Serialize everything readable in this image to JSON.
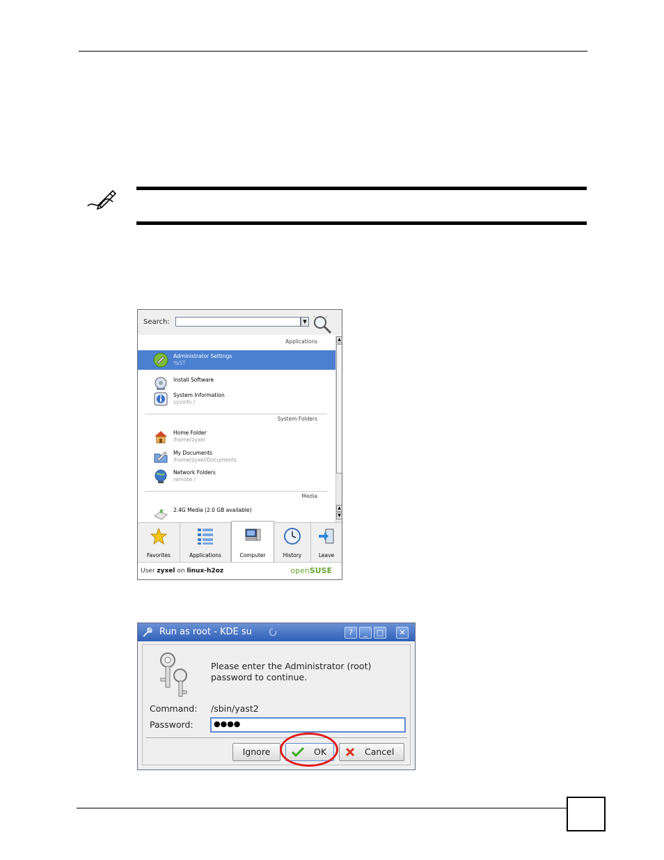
{
  "kde_menu": {
    "search_label": "Search:",
    "sections": [
      "Applications",
      "System Folders",
      "Media"
    ],
    "items": [
      {
        "title": "Administrator Settings",
        "subtitle": "YaST",
        "selected": true,
        "icon": "yast-icon"
      },
      {
        "title": "Install Software",
        "subtitle": "",
        "selected": false,
        "icon": "install-software-icon"
      },
      {
        "title": "System Information",
        "subtitle": "sysinfo /",
        "selected": false,
        "icon": "info-icon"
      },
      {
        "title": "Home Folder",
        "subtitle": "/home/zyxel",
        "selected": false,
        "icon": "home-folder-icon"
      },
      {
        "title": "My Documents",
        "subtitle": "/home/zyxel/Documents",
        "selected": false,
        "icon": "documents-folder-icon"
      },
      {
        "title": "Network Folders",
        "subtitle": "remote /",
        "selected": false,
        "icon": "network-globe-icon"
      },
      {
        "title": "2.4G Media (2.0 GB available)",
        "subtitle": "",
        "selected": false,
        "icon": "media-drive-icon"
      }
    ],
    "tabs": [
      {
        "label": "Favorites",
        "icon": "star-icon"
      },
      {
        "label": "Applications",
        "icon": "applications-list-icon"
      },
      {
        "label": "Computer",
        "icon": "computer-icon",
        "active": true
      },
      {
        "label": "History",
        "icon": "clock-icon"
      },
      {
        "label": "Leave",
        "icon": "leave-icon"
      }
    ],
    "status": {
      "prefix": "User",
      "user": "zyxel",
      "on": "on",
      "host": "linux-h2oz"
    },
    "brand": {
      "open": "open",
      "suse": "SUSE"
    }
  },
  "kdesu_dialog": {
    "title": "Run as root - KDE su",
    "message_line1": "Please enter the Administrator (root)",
    "message_line2": "password to continue.",
    "command_label": "Command:",
    "command_value": "/sbin/yast2",
    "password_label": "Password:",
    "password_value": "●●●●",
    "buttons": {
      "ignore": "Ignore",
      "ok": "OK",
      "cancel": "Cancel"
    }
  },
  "colors": {
    "selection": "#4b7fd0",
    "titlebar": "#2f5fb8",
    "highlight_ring": "#e21b1b",
    "brand": "#6aa62f"
  }
}
